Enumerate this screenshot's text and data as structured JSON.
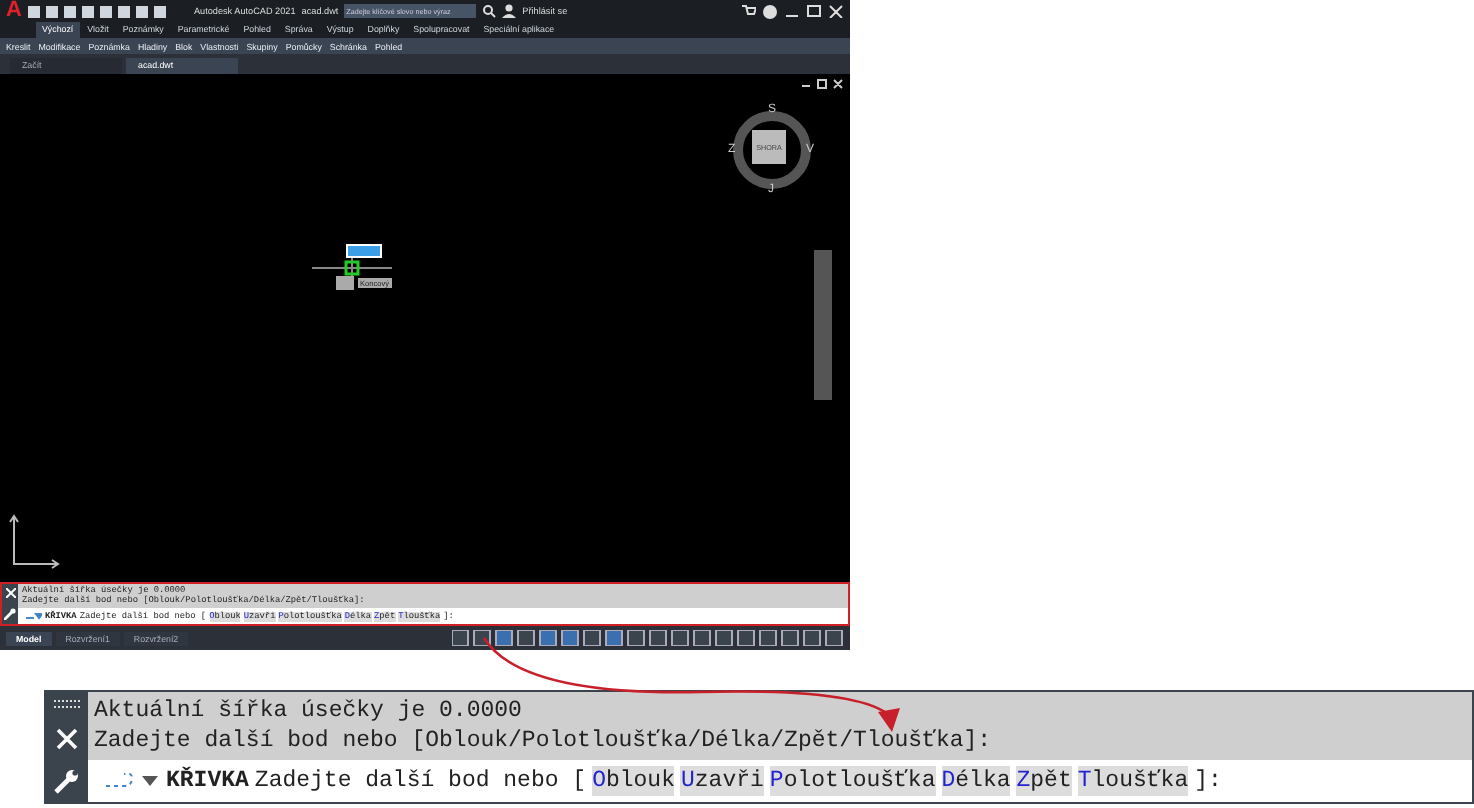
{
  "title_bar": {
    "logo": "A",
    "app_title": "Autodesk AutoCAD 2021",
    "file": "acad.dwt",
    "search_placeholder": "Zadejte klíčové slovo nebo výraz",
    "user": "Přihlásit se"
  },
  "ribbon_tabs": [
    {
      "label": "Výchozí",
      "selected": true
    },
    {
      "label": "Vložit",
      "selected": false
    },
    {
      "label": "Poznámky",
      "selected": false
    },
    {
      "label": "Parametrické",
      "selected": false
    },
    {
      "label": "Pohled",
      "selected": false
    },
    {
      "label": "Správa",
      "selected": false
    },
    {
      "label": "Výstup",
      "selected": false
    },
    {
      "label": "Doplňky",
      "selected": false
    },
    {
      "label": "Spolupracovat",
      "selected": false
    },
    {
      "label": "Speciální aplikace",
      "selected": false
    }
  ],
  "panels": [
    "Kreslit",
    "Modifikace",
    "Poznámka",
    "Hladiny",
    "Blok",
    "Vlastnosti",
    "Skupiny",
    "Pomůcky",
    "Schránka",
    "Pohled"
  ],
  "doc_tabs": [
    {
      "label": "Začít",
      "selected": false
    },
    {
      "label": "acad.dwt",
      "selected": true
    }
  ],
  "viewcube": {
    "north": "S",
    "south": "J",
    "east": "V",
    "west": "Z",
    "face": "SHORA"
  },
  "cursor": {
    "tooltip": "Koncový"
  },
  "command_line": {
    "history": [
      "Aktuální šířka úsečky je 0.0000",
      "Zadejte další bod nebo [Oblouk/Polotloušťka/Délka/Zpět/Tloušťka]:"
    ],
    "command": "KŘIVKA",
    "prompt": "Zadejte další bod nebo [",
    "options": [
      {
        "key": "O",
        "rest": "blouk"
      },
      {
        "key": "U",
        "rest": "zavři"
      },
      {
        "key": "P",
        "rest": "olotloušťka"
      },
      {
        "key": "D",
        "rest": "élka"
      },
      {
        "key": "Z",
        "rest": "pět"
      },
      {
        "key": "T",
        "rest": "loušťka"
      }
    ],
    "end": "]:"
  },
  "layout_tabs": [
    {
      "label": "Model",
      "selected": true
    },
    {
      "label": "Rozvržení1",
      "selected": false
    },
    {
      "label": "Rozvržení2",
      "selected": false
    }
  ],
  "inset": {
    "history": [
      "Aktuální šířka úsečky je 0.0000",
      "Zadejte další bod nebo [Oblouk/Polotloušťka/Délka/Zpět/Tloušťka]:"
    ],
    "command": "KŘIVKA",
    "prompt": "Zadejte další bod nebo [",
    "options": [
      {
        "key": "O",
        "rest": "blouk"
      },
      {
        "key": "U",
        "rest": "zavři"
      },
      {
        "key": "P",
        "rest": "olotloušťka"
      },
      {
        "key": "D",
        "rest": "élka"
      },
      {
        "key": "Z",
        "rest": "pět"
      },
      {
        "key": "T",
        "rest": "loušťka"
      }
    ],
    "end": "]:"
  }
}
